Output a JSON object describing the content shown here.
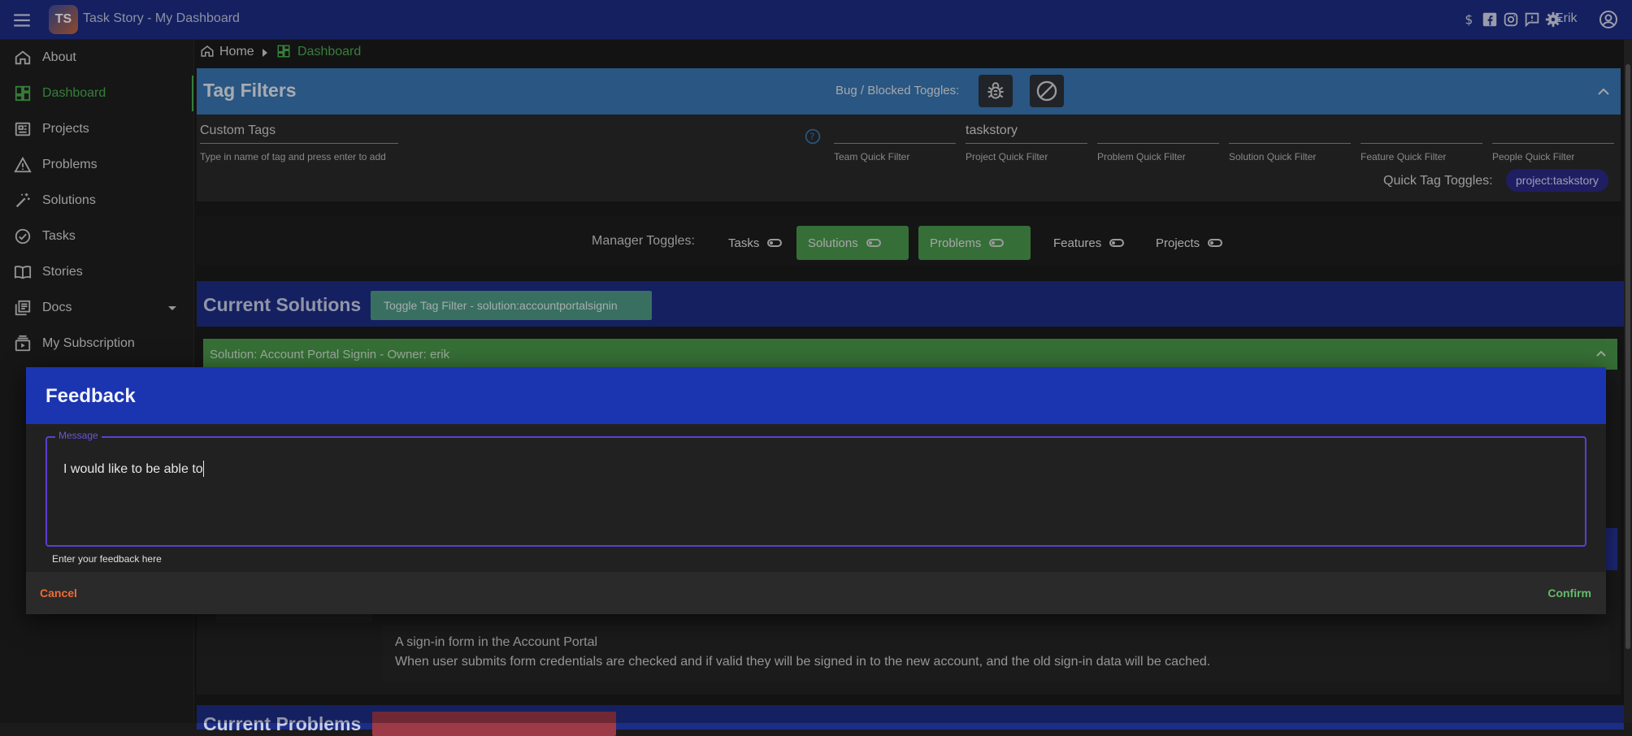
{
  "appbar": {
    "logo_text": "TS",
    "title": "Task Story - My Dashboard",
    "icons": [
      "menu-icon",
      "dollar-icon",
      "facebook-icon",
      "instagram-icon",
      "feedback-icon",
      "gear-icon",
      "account-circle-icon"
    ],
    "user": "Erik",
    "color": "#1c2d86"
  },
  "sidebar": {
    "items": [
      {
        "label": "About",
        "icon": "home-icon"
      },
      {
        "label": "Dashboard",
        "icon": "dashboard-icon",
        "active": true
      },
      {
        "label": "Projects",
        "icon": "projects-icon"
      },
      {
        "label": "Problems",
        "icon": "warning-icon"
      },
      {
        "label": "Solutions",
        "icon": "magic-wand-icon"
      },
      {
        "label": "Tasks",
        "icon": "check-circle-icon"
      },
      {
        "label": "Stories",
        "icon": "book-icon"
      },
      {
        "label": "Docs",
        "icon": "docs-icon",
        "expandable": true
      },
      {
        "label": "My Subscription",
        "icon": "subscription-icon"
      }
    ],
    "active_color": "#4caf50"
  },
  "breadcrumb": {
    "home": "Home",
    "current": "Dashboard"
  },
  "tag_filters": {
    "title": "Tag Filters",
    "bug_blocked_label": "Bug / Blocked Toggles:",
    "custom_tags_label": "Custom Tags",
    "custom_tags_hint": "Type in name of tag and press enter to add",
    "quick_filters": [
      {
        "hint": "Team Quick Filter",
        "value": ""
      },
      {
        "hint": "Project Quick Filter",
        "value": "taskstory"
      },
      {
        "hint": "Problem Quick Filter",
        "value": ""
      },
      {
        "hint": "Solution Quick Filter",
        "value": ""
      },
      {
        "hint": "Feature Quick Filter",
        "value": ""
      },
      {
        "hint": "People Quick Filter",
        "value": ""
      }
    ],
    "quick_tag_toggles_label": "Quick Tag Toggles:",
    "quick_tag_chip": "project:taskstory"
  },
  "manager_toggles": {
    "label": "Manager Toggles:",
    "items": [
      {
        "label": "Tasks",
        "on": false
      },
      {
        "label": "Solutions",
        "on": true
      },
      {
        "label": "Problems",
        "on": true
      },
      {
        "label": "Features",
        "on": false
      },
      {
        "label": "Projects",
        "on": false
      }
    ]
  },
  "current_solutions": {
    "title": "Current Solutions",
    "toggle_label": "Toggle Tag Filter - solution:accountportalsignin",
    "solution_bar": "Solution: Account Portal Signin - Owner: erik",
    "description_line1": "A sign-in form in the Account Portal",
    "description_line2": "When user submits form credentials are checked and if valid they will be signed in to the new account, and the old sign-in data will be cached."
  },
  "current_problems": {
    "title": "Current Problems"
  },
  "dialog": {
    "title": "Feedback",
    "message_legend": "Message",
    "message_value": "I would like to be able to ",
    "message_hint": "Enter your feedback here",
    "cancel": "Cancel",
    "confirm": "Confirm"
  }
}
